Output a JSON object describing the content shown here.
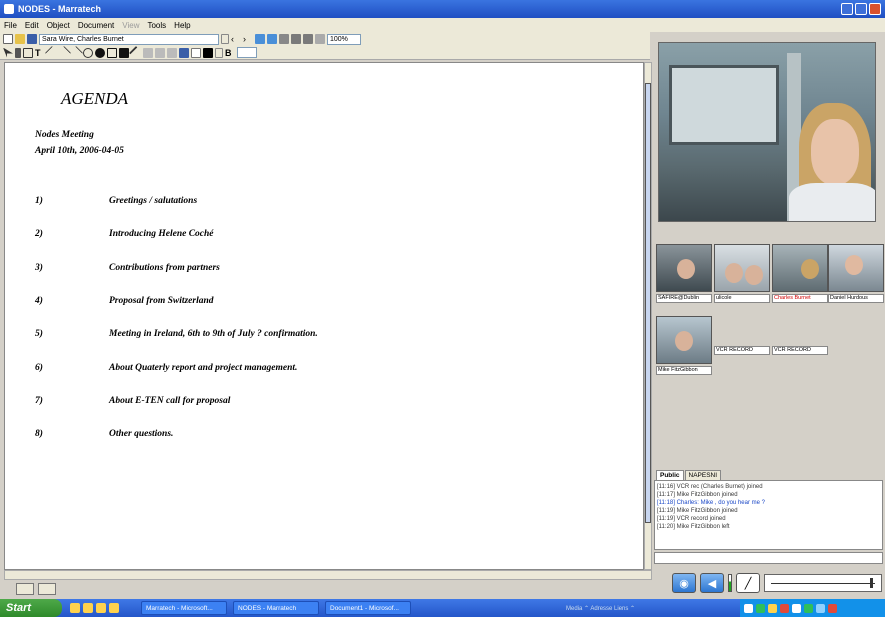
{
  "window": {
    "title": "NODES - Marratech"
  },
  "menu": [
    "File",
    "Edit",
    "Object",
    "Document",
    "View",
    "Tools",
    "Help"
  ],
  "menu_disabled": [
    "View"
  ],
  "toolbar": {
    "participant_combo": "Sara Wire, Charles Burnet",
    "zoom": "100%"
  },
  "document": {
    "title": "AGENDA",
    "meeting_name": "Nodes Meeting",
    "meeting_date": "April 10th, 2006-04-05",
    "items": [
      {
        "num": "1)",
        "text": "Greetings / salutations"
      },
      {
        "num": "2)",
        "text": "Introducing Helene Coché"
      },
      {
        "num": "3)",
        "text": "Contributions from partners"
      },
      {
        "num": "4)",
        "text": "Proposal from Switzerland"
      },
      {
        "num": "5)",
        "text": "Meeting in Ireland, 6th to 9th of July ? confirmation."
      },
      {
        "num": "6)",
        "text": "About Quaterly report and project management."
      },
      {
        "num": "7)",
        "text": "About E-TEN call for proposal"
      },
      {
        "num": "8)",
        "text": "Other questions."
      }
    ]
  },
  "participants": [
    {
      "name": "SAFIRE@Dublin",
      "highlight": false
    },
    {
      "name": "ulicole",
      "highlight": false
    },
    {
      "name": "Charles Burnet",
      "highlight": true
    },
    {
      "name": "Daniel Hurdous",
      "highlight": false
    },
    {
      "name": "Mike FitzGibbon",
      "highlight": false
    },
    {
      "name": "VCR RECORD",
      "highlight": false
    },
    {
      "name": "VCR RECORD",
      "highlight": false
    }
  ],
  "chat": {
    "tabs": [
      "Public",
      "NAPESNI"
    ],
    "lines": [
      {
        "text": "[11:16] VCR rec (Charles Burnet) joined",
        "blue": false
      },
      {
        "text": "[11:17] Mike FitzGibbon joined",
        "blue": false
      },
      {
        "text": "[11:18] Charles: Mike , do you hear me ?",
        "blue": true
      },
      {
        "text": "[11:19] Mike FitzGibbon joined",
        "blue": false
      },
      {
        "text": "[11:19] VCR record joined",
        "blue": false
      },
      {
        "text": "[11:20] Mike FitzGibbon left",
        "blue": false
      }
    ]
  },
  "audio": {
    "mic_level": 0.6,
    "volume": 0.95
  },
  "taskbar": {
    "start": "Start",
    "tasks": [
      "Marratech - Microsoft...",
      "NODES - Marratech",
      "Document1 - Microsof..."
    ],
    "tray_text": "Media ⌃  Adresse   Liens  ⌃"
  },
  "colors": {
    "title_bar": "#2456c9",
    "highlight_name": "#d00000",
    "chat_blue": "#1c49c7"
  }
}
